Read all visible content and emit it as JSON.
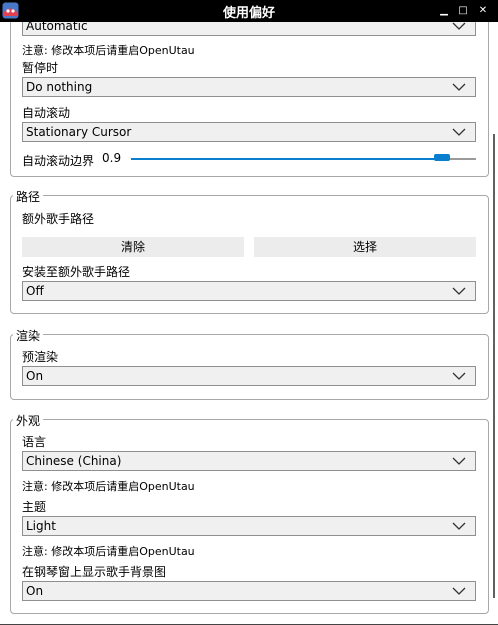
{
  "window": {
    "title": "使用偏好"
  },
  "playback": {
    "automatic_select": "Automatic",
    "restart_note": "注意: 修改本项后请重启OpenUtau",
    "on_pause_label": "暂停时",
    "on_pause_value": "Do nothing",
    "auto_scroll_label": "自动滚动",
    "auto_scroll_value": "Stationary Cursor",
    "auto_scroll_margin_label": "自动滚动边界",
    "auto_scroll_margin_value": "0.9",
    "auto_scroll_margin_fraction": 0.9
  },
  "paths": {
    "legend": "路径",
    "additional_singer_path_label": "额外歌手路径",
    "clear_button": "清除",
    "select_button": "选择",
    "install_to_additional_label": "安装至额外歌手路径",
    "install_to_additional_value": "Off"
  },
  "render": {
    "legend": "渲染",
    "prerender_label": "预渲染",
    "prerender_value": "On"
  },
  "appearance": {
    "legend": "外观",
    "language_label": "语言",
    "language_value": "Chinese (China)",
    "language_note": "注意: 修改本项后请重启OpenUtau",
    "theme_label": "主题",
    "theme_value": "Light",
    "theme_note": "注意: 修改本项后请重启OpenUtau",
    "show_portrait_label": "在钢琴窗上显示歌手背景图",
    "show_portrait_value": "On"
  },
  "colors": {
    "accent": "#0a7fd0",
    "titlebar": "#000000"
  }
}
